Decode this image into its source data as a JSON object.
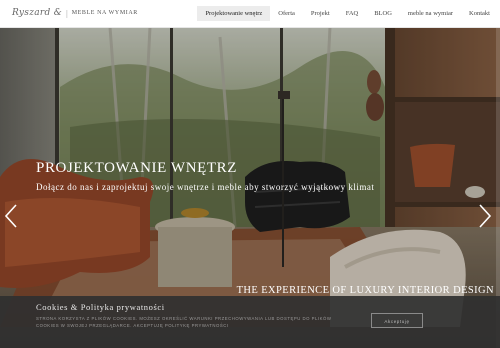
{
  "header": {
    "logo": {
      "script": "Ryszard & ",
      "separator": "|",
      "text": "MEBLE NA WYMIAR"
    },
    "nav": [
      {
        "label": "Projektowanie wnętrz",
        "active": true
      },
      {
        "label": "Oferta",
        "active": false
      },
      {
        "label": "Projekt",
        "active": false
      },
      {
        "label": "FAQ",
        "active": false
      },
      {
        "label": "BLOG",
        "active": false
      },
      {
        "label": "meble na wymiar",
        "active": false
      },
      {
        "label": "Kontakt",
        "active": false
      }
    ]
  },
  "hero": {
    "title": "PROJEKTOWANIE WNĘTRZ",
    "subtitle": "Dołącz do nas i zaprojektuj swoje wnętrze i meble aby stworzyć wyjątkowy klimat",
    "tagline": "THE EXPERIENCE OF LUXURY INTERIOR DESIGN",
    "arrows": {
      "prev": "chevron-left-icon",
      "next": "chevron-right-icon"
    }
  },
  "cookie": {
    "title": "Cookies & Polityka prywatności",
    "text": "Strona korzysta z plików cookies. Możesz określić warunki przechowywania lub dostępu do plików cookies w swojej przeglądarce. Akceptuję politykę prywatności",
    "button": "Akceptuję"
  }
}
